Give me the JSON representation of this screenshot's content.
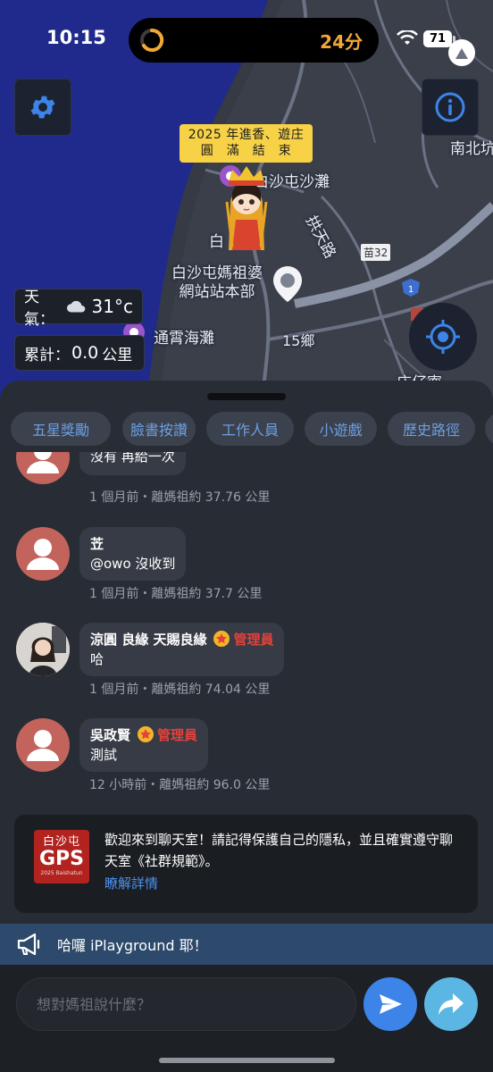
{
  "status_bar": {
    "time": "10:15",
    "activity_minutes": "24分",
    "battery": "71"
  },
  "map": {
    "announcement": "2025 年進香、遊庄\n圓　滿　結　束",
    "labels": {
      "beach_north": "白沙屯沙灘",
      "town": "白沙屯媽祖婆\n網站站本部",
      "sea_beach": "通霄海灘",
      "road_gong": "拱天路",
      "road_15": "15鄉",
      "route_32": "苗32",
      "nanbei": "南北坑",
      "zhaizaicuo": "庄仔寮",
      "bai": "白"
    },
    "icons": {
      "settings": "gear-icon",
      "info": "info-icon",
      "locate": "crosshair-icon"
    },
    "weather": {
      "label": "天氣：",
      "temperature": "31°c",
      "icon": "cloud-icon"
    },
    "distance": {
      "label": "累計：",
      "value": "0.0",
      "unit": "公里"
    }
  },
  "tabs": [
    {
      "label": "五星獎勵"
    },
    {
      "label": "臉書按讚"
    },
    {
      "label": "工作人員"
    },
    {
      "label": "小遊戲"
    },
    {
      "label": "歷史路徑"
    }
  ],
  "messages": [
    {
      "name": "",
      "text": "沒有 再給一次",
      "meta": "1 個月前・離媽祖約 37.76 公里",
      "avatar": "default"
    },
    {
      "name": "苙",
      "text": "@owo 沒收到",
      "meta": "1 個月前・離媽祖約 37.7 公里",
      "avatar": "default"
    },
    {
      "name": "涼圓 良緣 天賜良緣",
      "badge": "管理員",
      "text": "哈",
      "meta": "1 個月前・離媽祖約 74.04 公里",
      "avatar": "photo"
    },
    {
      "name": "吳政賢",
      "badge": "管理員",
      "text": "測試",
      "meta": "12 小時前・離媽祖約 96.0 公里",
      "avatar": "default"
    }
  ],
  "welcome": {
    "logo_top": "白沙屯",
    "logo_main": "GPS",
    "logo_sub": "2025 Baishatun",
    "text": "歡迎來到聊天室！請記得保護自己的隱私，並且確實遵守聊天室《社群規範》。",
    "link": "瞭解詳情"
  },
  "ticker": {
    "icon": "megaphone-icon",
    "text": "哈囉 iPlayground 耶！"
  },
  "input": {
    "placeholder": "想對媽祖說什麼？",
    "send_icon": "send-icon",
    "share_icon": "share-icon"
  },
  "colors": {
    "accent": "#3d84e8",
    "admin_red": "#e3423a",
    "tab_text": "#6d9fe2",
    "announcement_bg": "#f7d246"
  }
}
